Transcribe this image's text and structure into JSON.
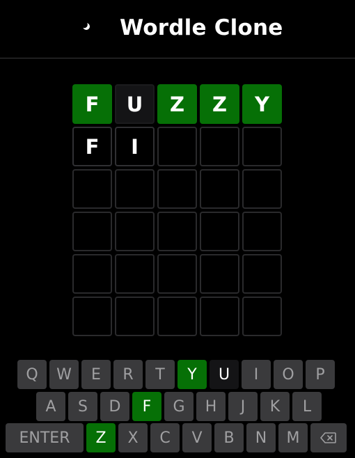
{
  "header": {
    "title": "Wordle Clone",
    "theme_icon": "moon-icon"
  },
  "colors": {
    "background": "#000000",
    "correct": "#067006",
    "absent": "#141416",
    "key_default": "#3a3a3c",
    "tile_border": "#2a2a2c"
  },
  "board": {
    "rows": [
      [
        {
          "letter": "F",
          "state": "correct"
        },
        {
          "letter": "U",
          "state": "absent"
        },
        {
          "letter": "Z",
          "state": "correct"
        },
        {
          "letter": "Z",
          "state": "correct"
        },
        {
          "letter": "Y",
          "state": "correct"
        }
      ],
      [
        {
          "letter": "F",
          "state": "filled"
        },
        {
          "letter": "I",
          "state": "filled"
        },
        {
          "letter": "",
          "state": "empty"
        },
        {
          "letter": "",
          "state": "empty"
        },
        {
          "letter": "",
          "state": "empty"
        }
      ],
      [
        {
          "letter": "",
          "state": "empty"
        },
        {
          "letter": "",
          "state": "empty"
        },
        {
          "letter": "",
          "state": "empty"
        },
        {
          "letter": "",
          "state": "empty"
        },
        {
          "letter": "",
          "state": "empty"
        }
      ],
      [
        {
          "letter": "",
          "state": "empty"
        },
        {
          "letter": "",
          "state": "empty"
        },
        {
          "letter": "",
          "state": "empty"
        },
        {
          "letter": "",
          "state": "empty"
        },
        {
          "letter": "",
          "state": "empty"
        }
      ],
      [
        {
          "letter": "",
          "state": "empty"
        },
        {
          "letter": "",
          "state": "empty"
        },
        {
          "letter": "",
          "state": "empty"
        },
        {
          "letter": "",
          "state": "empty"
        },
        {
          "letter": "",
          "state": "empty"
        }
      ],
      [
        {
          "letter": "",
          "state": "empty"
        },
        {
          "letter": "",
          "state": "empty"
        },
        {
          "letter": "",
          "state": "empty"
        },
        {
          "letter": "",
          "state": "empty"
        },
        {
          "letter": "",
          "state": "empty"
        }
      ]
    ]
  },
  "keyboard": {
    "rows": [
      [
        {
          "label": "Q",
          "state": "default"
        },
        {
          "label": "W",
          "state": "default"
        },
        {
          "label": "E",
          "state": "default"
        },
        {
          "label": "R",
          "state": "default"
        },
        {
          "label": "T",
          "state": "default"
        },
        {
          "label": "Y",
          "state": "correct"
        },
        {
          "label": "U",
          "state": "absent"
        },
        {
          "label": "I",
          "state": "default"
        },
        {
          "label": "O",
          "state": "default"
        },
        {
          "label": "P",
          "state": "default"
        }
      ],
      [
        {
          "label": "A",
          "state": "default"
        },
        {
          "label": "S",
          "state": "default"
        },
        {
          "label": "D",
          "state": "default"
        },
        {
          "label": "F",
          "state": "correct"
        },
        {
          "label": "G",
          "state": "default"
        },
        {
          "label": "H",
          "state": "default"
        },
        {
          "label": "J",
          "state": "default"
        },
        {
          "label": "K",
          "state": "default"
        },
        {
          "label": "L",
          "state": "default"
        }
      ],
      [
        {
          "label": "ENTER",
          "state": "default",
          "kind": "enter"
        },
        {
          "label": "Z",
          "state": "correct"
        },
        {
          "label": "X",
          "state": "default"
        },
        {
          "label": "C",
          "state": "default"
        },
        {
          "label": "V",
          "state": "default"
        },
        {
          "label": "B",
          "state": "default"
        },
        {
          "label": "N",
          "state": "default"
        },
        {
          "label": "M",
          "state": "default"
        },
        {
          "label": "",
          "state": "default",
          "kind": "backspace",
          "icon": "backspace-icon"
        }
      ]
    ]
  }
}
